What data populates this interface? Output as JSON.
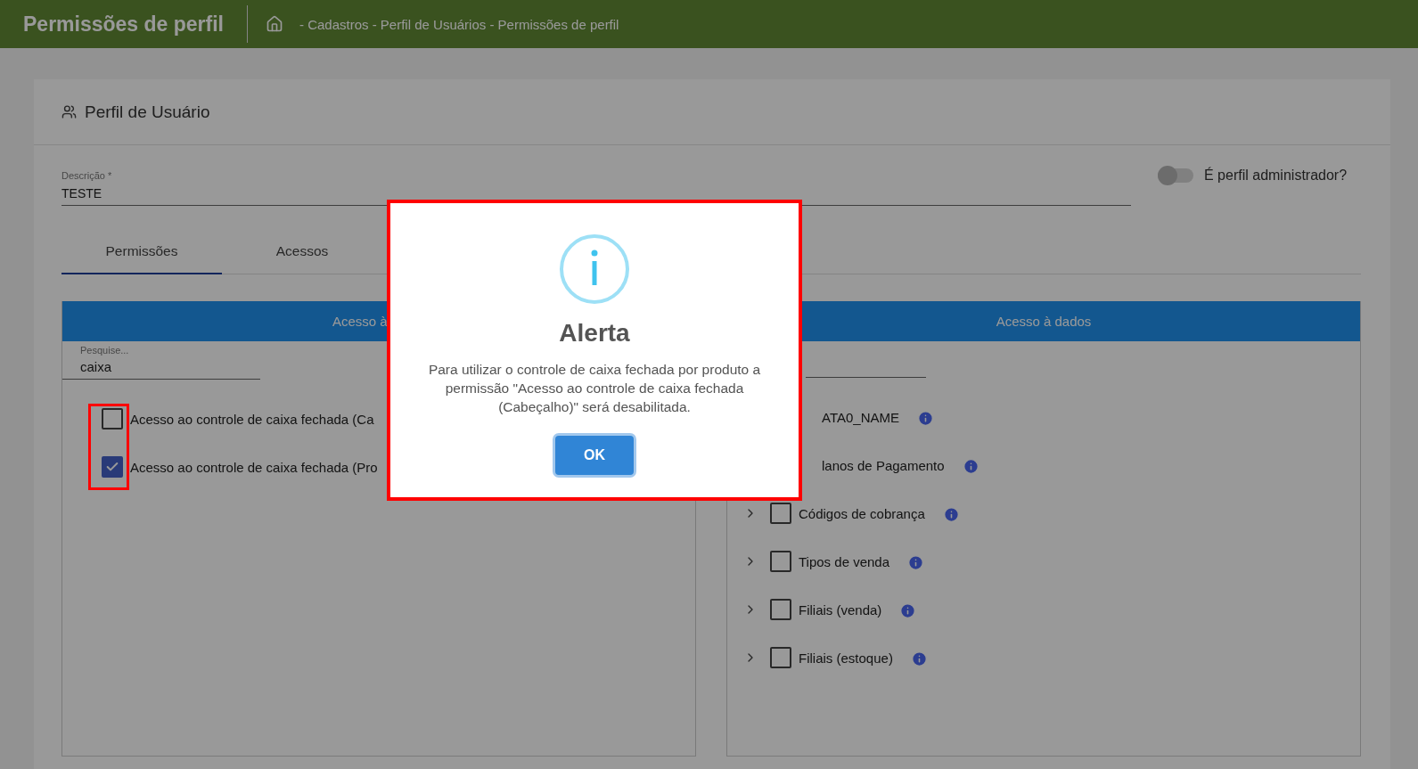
{
  "header": {
    "title": "Permissões de perfil",
    "breadcrumb": "- Cadastros - Perfil de Usuários - Permissões de perfil"
  },
  "card": {
    "title": "Perfil de Usuário"
  },
  "description_field": {
    "label": "Descrição *",
    "value": "TESTE"
  },
  "admin_toggle": {
    "label": "É perfil administrador?",
    "on": false
  },
  "tabs": [
    {
      "label": "Permissões",
      "selected": true
    },
    {
      "label": "Acessos",
      "selected": false
    }
  ],
  "left_panel": {
    "title": "Acesso à",
    "search": {
      "label": "Pesquise...",
      "value": "caixa"
    },
    "items": [
      {
        "label": "Acesso ao controle de caixa fechada (Ca",
        "checked": false
      },
      {
        "label": "Acesso ao controle de caixa fechada (Pro",
        "checked": true
      }
    ]
  },
  "right_panel": {
    "title": "Acesso à dados",
    "items": [
      {
        "label": "ATA0_NAME"
      },
      {
        "label": "lanos de Pagamento"
      },
      {
        "label": "Códigos de cobrança",
        "checked": false
      },
      {
        "label": "Tipos de venda",
        "checked": false
      },
      {
        "label": "Filiais (venda)",
        "checked": false
      },
      {
        "label": "Filiais (estoque)",
        "checked": false
      }
    ]
  },
  "dialog": {
    "title": "Alerta",
    "message": "Para utilizar o controle de caixa fechada por produto a permissão \"Acesso ao controle de caixa fechada (Cabeçalho)\" será desabilitada.",
    "button": "OK"
  }
}
